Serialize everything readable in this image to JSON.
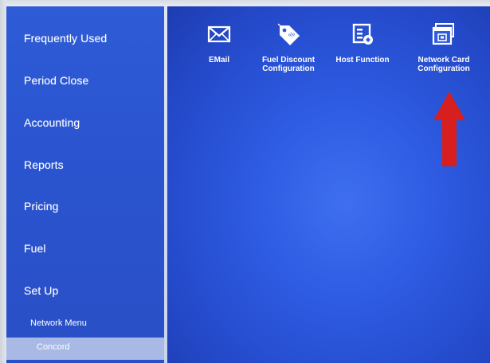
{
  "sidebar": {
    "items": [
      {
        "label": "Frequently Used"
      },
      {
        "label": "Period Close"
      },
      {
        "label": "Accounting"
      },
      {
        "label": "Reports"
      },
      {
        "label": "Pricing"
      },
      {
        "label": "Fuel"
      },
      {
        "label": "Set Up"
      }
    ],
    "submenu": {
      "network_menu": "Network Menu",
      "selected": "Concord"
    }
  },
  "tiles": [
    {
      "label": "EMail",
      "icon": "envelope-icon"
    },
    {
      "label": "Fuel Discount\nConfiguration",
      "icon": "price-tag-icon"
    },
    {
      "label": "Host Function",
      "icon": "host-function-icon"
    },
    {
      "label": "Network Card\nConfiguration",
      "icon": "network-card-icon"
    }
  ],
  "colors": {
    "sidebar": "#2f5bd6",
    "main": "#2e5ce3",
    "selected": "#a9b9e6",
    "arrow": "#d81f1f"
  }
}
